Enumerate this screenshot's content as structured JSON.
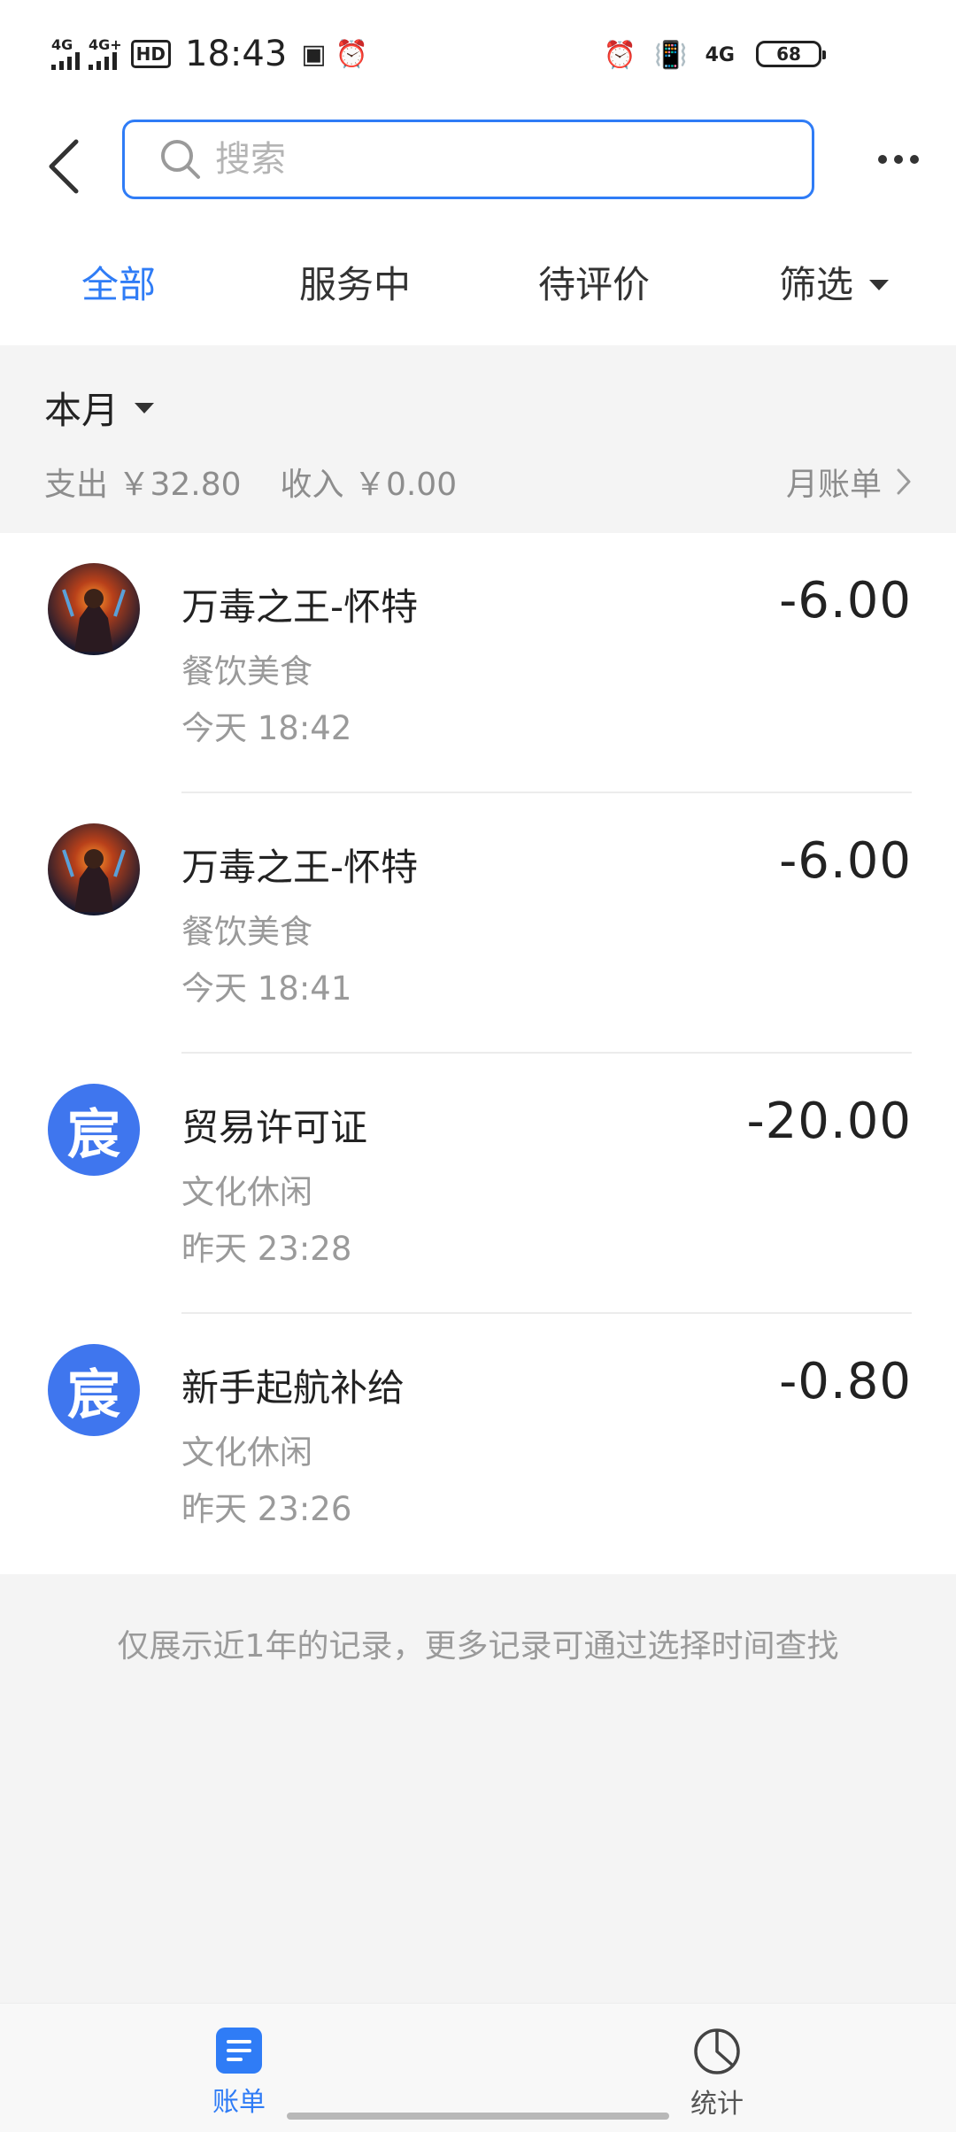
{
  "status_bar": {
    "net1": "4G",
    "net2": "4G+",
    "hd": "HD",
    "time": "18:43",
    "right_net": "4G",
    "battery": "68"
  },
  "header": {
    "search_placeholder": "搜索"
  },
  "tabs": [
    {
      "label": "全部",
      "active": true
    },
    {
      "label": "服务中",
      "active": false
    },
    {
      "label": "待评价",
      "active": false
    },
    {
      "label": "筛选",
      "active": false
    }
  ],
  "summary": {
    "month": "本月",
    "expense": "支出 ￥32.80",
    "income": "收入 ￥0.00",
    "bill_link": "月账单"
  },
  "transactions": [
    {
      "title": "万毒之王-怀特",
      "category": "餐饮美食",
      "time": "今天  18:42",
      "amount": "-6.00",
      "avatar_type": "game-art"
    },
    {
      "title": "万毒之王-怀特",
      "category": "餐饮美食",
      "time": "今天  18:41",
      "amount": "-6.00",
      "avatar_type": "game-art"
    },
    {
      "title": "贸易许可证",
      "category": "文化休闲",
      "time": "昨天  23:28",
      "amount": "-20.00",
      "avatar_type": "letter",
      "avatar_letter": "宸"
    },
    {
      "title": "新手起航补给",
      "category": "文化休闲",
      "time": "昨天  23:26",
      "amount": "-0.80",
      "avatar_type": "letter",
      "avatar_letter": "宸"
    }
  ],
  "note": "仅展示近1年的记录，更多记录可通过选择时间查找",
  "bottom_nav": [
    {
      "label": "账单",
      "icon": "bill-icon",
      "active": true
    },
    {
      "label": "统计",
      "icon": "pie-chart-icon",
      "active": false
    }
  ],
  "colors": {
    "accent": "#2f7cf6",
    "avatar_letter_bg": "#3f76ee"
  }
}
